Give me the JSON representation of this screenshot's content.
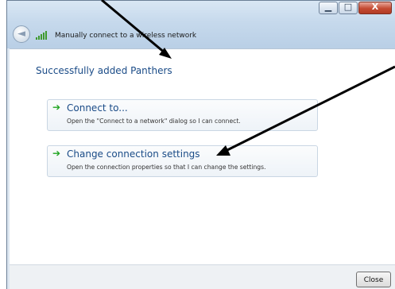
{
  "window": {
    "title": "Manually connect to a wireless network",
    "controls": {
      "minimize": "▁",
      "maximize": "□",
      "close": "X"
    }
  },
  "back_button": {
    "glyph": "◄"
  },
  "content": {
    "heading": "Successfully added Panthers",
    "options": [
      {
        "title": "Connect to...",
        "description": "Open the \"Connect to a network\" dialog so I can connect.",
        "arrow": "➔"
      },
      {
        "title": "Change connection settings",
        "description": "Open the connection properties so that I can change the settings.",
        "arrow": "➔"
      }
    ]
  },
  "footer": {
    "close_label": "Close"
  },
  "colors": {
    "accent_text": "#1a4b87",
    "arrow_green": "#21a521",
    "window_frame": "#dde7f1"
  }
}
